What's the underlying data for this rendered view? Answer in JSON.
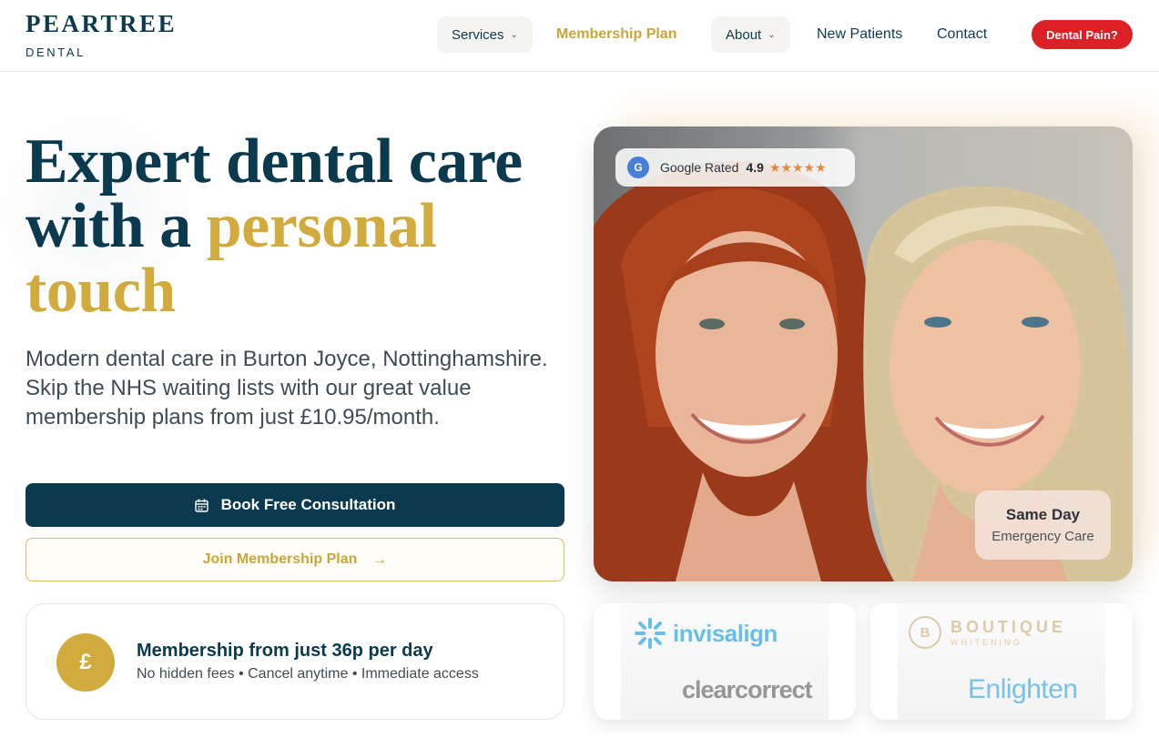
{
  "header": {
    "logo_top": "PEARTREE",
    "logo_bottom": "DENTAL",
    "nav": {
      "services": "Services",
      "membership": "Membership Plan",
      "about": "About",
      "new_patients": "New Patients",
      "contact": "Contact"
    },
    "cta": "Dental Pain?"
  },
  "hero": {
    "headline_line1": "Expert dental care",
    "headline_line2_a": "with a ",
    "headline_line2_b": "personal",
    "headline_line3": "touch",
    "lead": "Modern dental care in Burton Joyce, Nottinghamshire. Skip the NHS waiting lists with our great value membership plans from just £10.95/month.",
    "primary_button": "Book Free Consultation",
    "secondary_button": "Join Membership Plan"
  },
  "membership_card": {
    "icon_glyph": "£",
    "title": "Membership from just 36p per day",
    "subtitle": "No hidden fees • Cancel anytime • Immediate access"
  },
  "photo": {
    "rating": {
      "badge": "G",
      "label": "Google Rated",
      "score": "4.9",
      "stars": "★★★★★",
      "stars_value": 5
    },
    "same_day": {
      "title": "Same Day",
      "subtitle": "Emergency Care"
    }
  },
  "brands": {
    "invisalign": "invisalign",
    "clearcorrect": "clearcorrect",
    "boutique_top": "BOUTIQUE",
    "boutique_bottom": "WHITENING",
    "boutique_mark": "B",
    "enlighten": "Enlighten"
  },
  "colors": {
    "navy": "#0b3a4f",
    "gold": "#d2ab3f",
    "red": "#dd1f26"
  }
}
